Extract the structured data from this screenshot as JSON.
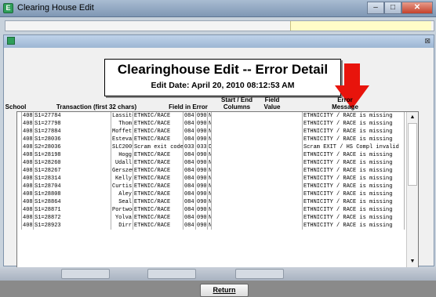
{
  "window": {
    "title": "Clearing House Edit"
  },
  "report": {
    "title": "Clearinghouse Edit  --  Error Detail",
    "edit_date": "Edit Date: April 20, 2010   08:12:53 AM"
  },
  "columns": {
    "school": "School",
    "transaction": "Transaction (first 32 chars)",
    "field_in_error": "Field in Error",
    "start_end_line1": "Start / End",
    "start_end_line2": "Columns",
    "field_value_line1": "Field",
    "field_value_line2": "Value",
    "error_line1": "Error",
    "error_line2": "Message"
  },
  "rows": [
    {
      "school": "408",
      "trans": "S1=27784",
      "name": "Lassiter",
      "field": "ETHNIC/RACE",
      "start": "084",
      "end": "090",
      "value": "N",
      "message": "ETHNICITY / RACE is missing"
    },
    {
      "school": "408",
      "trans": "S1=27798",
      "name": "Thom",
      "field": "ETHNIC/RACE",
      "start": "084",
      "end": "090",
      "value": "N",
      "message": "ETHNICITY / RACE is missing"
    },
    {
      "school": "408",
      "trans": "S1=27884",
      "name": "Moffett",
      "field": "ETHNIC/RACE",
      "start": "084",
      "end": "090",
      "value": "N",
      "message": "ETHNICITY / RACE is missing"
    },
    {
      "school": "408",
      "trans": "S1=28036",
      "name": "Estevan",
      "field": "ETHNIC/RACE",
      "start": "084",
      "end": "090",
      "value": "N",
      "message": "ETHNICITY / RACE is missing"
    },
    {
      "school": "408",
      "trans": "S2=28036",
      "name": "SLC2009082420091127",
      "field": "Scram exit code",
      "start": "033",
      "end": "033",
      "value": "D",
      "message": "Scram EXIT / HS Compl invalid"
    },
    {
      "school": "408",
      "trans": "S1=28198",
      "name": "Hogg",
      "field": "ETHNIC/RACE",
      "start": "084",
      "end": "090",
      "value": "N",
      "message": "ETHNICITY / RACE is missing"
    },
    {
      "school": "408",
      "trans": "S1=28260",
      "name": "Udall",
      "field": "ETHNIC/RACE",
      "start": "084",
      "end": "090",
      "value": "N",
      "message": "ETHNICITY / RACE is missing"
    },
    {
      "school": "408",
      "trans": "S1=28267",
      "name": "Gerszewski",
      "field": "ETHNIC/RACE",
      "start": "084",
      "end": "090",
      "value": "N",
      "message": "ETHNICITY / RACE is missing"
    },
    {
      "school": "408",
      "trans": "S1=28314",
      "name": "Kelly",
      "field": "ETHNIC/RACE",
      "start": "084",
      "end": "090",
      "value": "N",
      "message": "ETHNICITY / RACE is missing"
    },
    {
      "school": "408",
      "trans": "S1=28704",
      "name": "Curtiss",
      "field": "ETHNIC/RACE",
      "start": "084",
      "end": "090",
      "value": "N",
      "message": "ETHNICITY / RACE is missing"
    },
    {
      "school": "408",
      "trans": "S1=28808",
      "name": "Aley",
      "field": "ETHNIC/RACE",
      "start": "084",
      "end": "090",
      "value": "N",
      "message": "ETHNICITY / RACE is missing"
    },
    {
      "school": "408",
      "trans": "S1=28864",
      "name": "Seal",
      "field": "ETHNIC/RACE",
      "start": "084",
      "end": "090",
      "value": "N",
      "message": "ETHNICITY / RACE is missing"
    },
    {
      "school": "408",
      "trans": "S1=28871",
      "name": "Portwood",
      "field": "ETHNIC/RACE",
      "start": "084",
      "end": "090",
      "value": "N",
      "message": "ETHNICITY / RACE is missing"
    },
    {
      "school": "408",
      "trans": "S1=28872",
      "name": "Yolva",
      "field": "ETHNIC/RACE",
      "start": "084",
      "end": "090",
      "value": "N",
      "message": "ETHNICITY / RACE is missing"
    },
    {
      "school": "408",
      "trans": "S1=28923",
      "name": "Dirr",
      "field": "ETHNIC/RACE",
      "start": "084",
      "end": "090",
      "value": "N",
      "message": "ETHNICITY / RACE is missing"
    }
  ],
  "buttons": {
    "return": "Return"
  },
  "colors": {
    "arrow": "#e8140c",
    "titlebar": "#9db6d3"
  },
  "icons": {
    "app": "app-icon",
    "close": "close-icon",
    "scroll_up": "scroll-up-icon",
    "scroll_down": "scroll-down-icon"
  }
}
